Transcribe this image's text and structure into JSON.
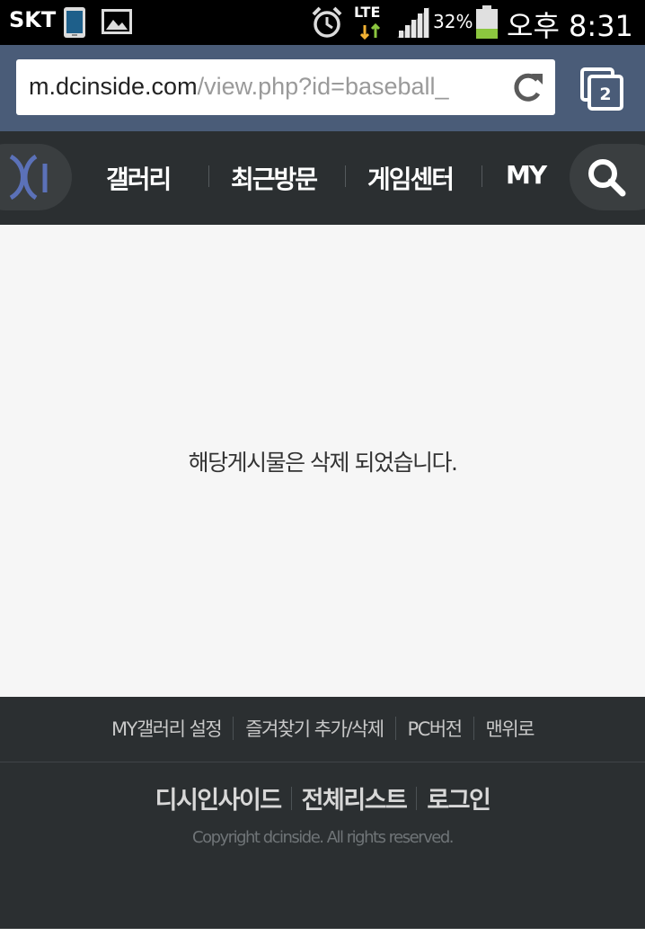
{
  "status_bar": {
    "carrier": "SKT",
    "network": "LTE",
    "battery_percent": "32%",
    "time": "오후 8:31",
    "icons": [
      "phone-icon",
      "gallery-icon",
      "alarm-icon",
      "lte-data-icon",
      "signal-icon",
      "battery-icon"
    ],
    "battery_level": 0.32,
    "battery_color": "#8cc63f"
  },
  "browser": {
    "url_domain": "m.dcinside.com",
    "url_path": "/view.php?id=baseball_",
    "tab_count": "2",
    "bar_color": "#4a5c78"
  },
  "nav": {
    "items": [
      {
        "label": "갤러리"
      },
      {
        "label": "최근방문"
      },
      {
        "label": "게임센터"
      },
      {
        "label": "MY"
      }
    ],
    "background": "#2b2f31"
  },
  "main": {
    "message": "해당게시물은 삭제 되었습니다."
  },
  "footer": {
    "links": [
      {
        "label": "MY갤러리 설정"
      },
      {
        "label": "즐겨찾기 추가/삭제"
      },
      {
        "label": "PC버전"
      },
      {
        "label": "맨위로"
      }
    ],
    "main_links": [
      {
        "label": "디시인사이드"
      },
      {
        "label": "전체리스트"
      },
      {
        "label": "로그인"
      }
    ],
    "copyright": "Copyright dcinside. All rights reserved."
  }
}
